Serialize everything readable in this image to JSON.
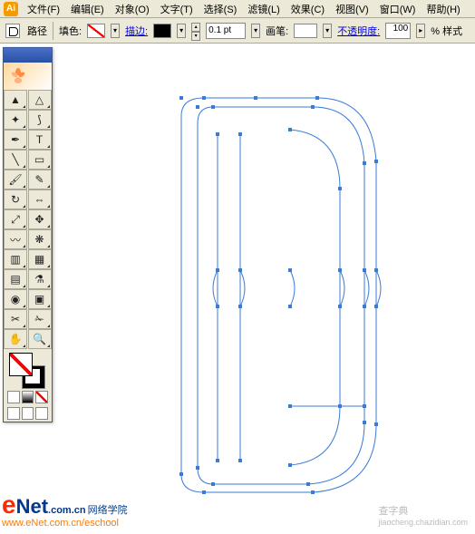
{
  "menubar": {
    "items": [
      {
        "label": "文件(F)"
      },
      {
        "label": "编辑(E)"
      },
      {
        "label": "对象(O)"
      },
      {
        "label": "文字(T)"
      },
      {
        "label": "选择(S)"
      },
      {
        "label": "滤镜(L)"
      },
      {
        "label": "效果(C)"
      },
      {
        "label": "视图(V)"
      },
      {
        "label": "窗口(W)"
      },
      {
        "label": "帮助(H)"
      }
    ]
  },
  "optbar": {
    "path_label": "路径",
    "fill_label": "填色:",
    "stroke_label": "描边:",
    "weight_value": "0.1 pt",
    "brush_label": "画笔:",
    "opacity_label": "不透明度:",
    "opacity_value": "100",
    "opacity_suffix": "% 样式",
    "fill_color": "none",
    "stroke_color": "#000000"
  },
  "tools": [
    {
      "name": "selection-tool",
      "glyph": "▲"
    },
    {
      "name": "direct-selection-tool",
      "glyph": "△"
    },
    {
      "name": "magic-wand-tool",
      "glyph": "✦"
    },
    {
      "name": "lasso-tool",
      "glyph": "⟆"
    },
    {
      "name": "pen-tool",
      "glyph": "✒"
    },
    {
      "name": "type-tool",
      "glyph": "T"
    },
    {
      "name": "line-tool",
      "glyph": "╲"
    },
    {
      "name": "rectangle-tool",
      "glyph": "▭"
    },
    {
      "name": "paintbrush-tool",
      "glyph": "🖌"
    },
    {
      "name": "pencil-tool",
      "glyph": "✎"
    },
    {
      "name": "rotate-tool",
      "glyph": "↻"
    },
    {
      "name": "reflect-tool",
      "glyph": "⇔"
    },
    {
      "name": "scale-tool",
      "glyph": "⤢"
    },
    {
      "name": "free-transform-tool",
      "glyph": "✥"
    },
    {
      "name": "warp-tool",
      "glyph": "〰"
    },
    {
      "name": "symbol-sprayer-tool",
      "glyph": "❋"
    },
    {
      "name": "column-graph-tool",
      "glyph": "▥"
    },
    {
      "name": "mesh-tool",
      "glyph": "▦"
    },
    {
      "name": "gradient-tool",
      "glyph": "▤"
    },
    {
      "name": "eyedropper-tool",
      "glyph": "⚗"
    },
    {
      "name": "blend-tool",
      "glyph": "◉"
    },
    {
      "name": "live-paint-tool",
      "glyph": "▣"
    },
    {
      "name": "slice-tool",
      "glyph": "✂"
    },
    {
      "name": "scissors-tool",
      "glyph": "✁"
    },
    {
      "name": "hand-tool",
      "glyph": "✋"
    },
    {
      "name": "zoom-tool",
      "glyph": "🔍"
    }
  ],
  "branding": {
    "enet_e": "e",
    "enet_net": "Net",
    "enet_com": ".com.cn",
    "enet_zh": "网络学院",
    "enet_url": "www.eNet.com.cn/eschool",
    "wm_main": "查字典",
    "wm_sub": "jiaocheng.chazidian.com"
  }
}
